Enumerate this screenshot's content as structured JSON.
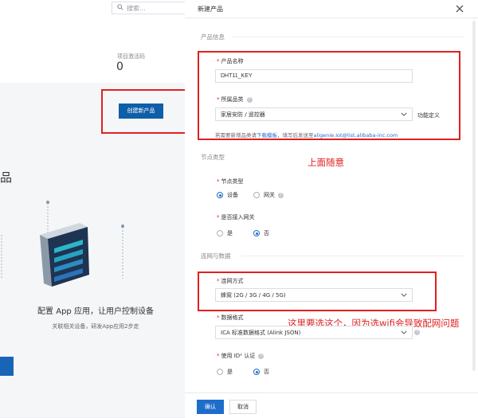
{
  "background": {
    "search_placeholder": "搜索...",
    "stat_label": "项目激活码",
    "stat_value": "0",
    "create_button": "创建新产品",
    "cut_heading": "品",
    "headline": "配置 App 应用，让用户控制设备",
    "subline": "关联相关设备，研发App应用2步走"
  },
  "dialog": {
    "title": "新建产品",
    "sections": {
      "product_info": "产品信息",
      "node_type": "节点类型",
      "network": "连网与数据"
    },
    "product_name": {
      "label": "产品名称",
      "value": "DHT11_KEY"
    },
    "category": {
      "label": "所属品类",
      "value": "家居安防 / 遥控器",
      "suffix": "功能定义",
      "hint_prefix": "若需要新增品类请",
      "hint_link": "下载模板",
      "hint_middle": "，填写后发送至",
      "hint_email": "aligenie.iot@list.alibaba-inc.com"
    },
    "node_type": {
      "label": "节点类型",
      "options": [
        "设备",
        "网关"
      ],
      "selected": "设备"
    },
    "gateway": {
      "label": "是否接入网关",
      "options": [
        "是",
        "否"
      ],
      "selected": "否"
    },
    "network_method": {
      "label": "连网方式",
      "value": "蜂窝 (2G / 3G / 4G / 5G)"
    },
    "data_format": {
      "label": "数据格式",
      "value": "ICA 标准数据格式 (Alink JSON)"
    },
    "id2": {
      "label": "使用 ID² 认证",
      "options": [
        "是",
        "否"
      ],
      "selected": "否"
    },
    "footer": {
      "confirm": "确认",
      "cancel": "取消"
    }
  },
  "annotations": {
    "top": "上面随意",
    "bottom": "这里要选这个，因为选wifi会导致配网问题"
  },
  "colors": {
    "accent": "#1f6dcb",
    "annotation": "#e02020",
    "bg_button": "#0f5ea8"
  }
}
